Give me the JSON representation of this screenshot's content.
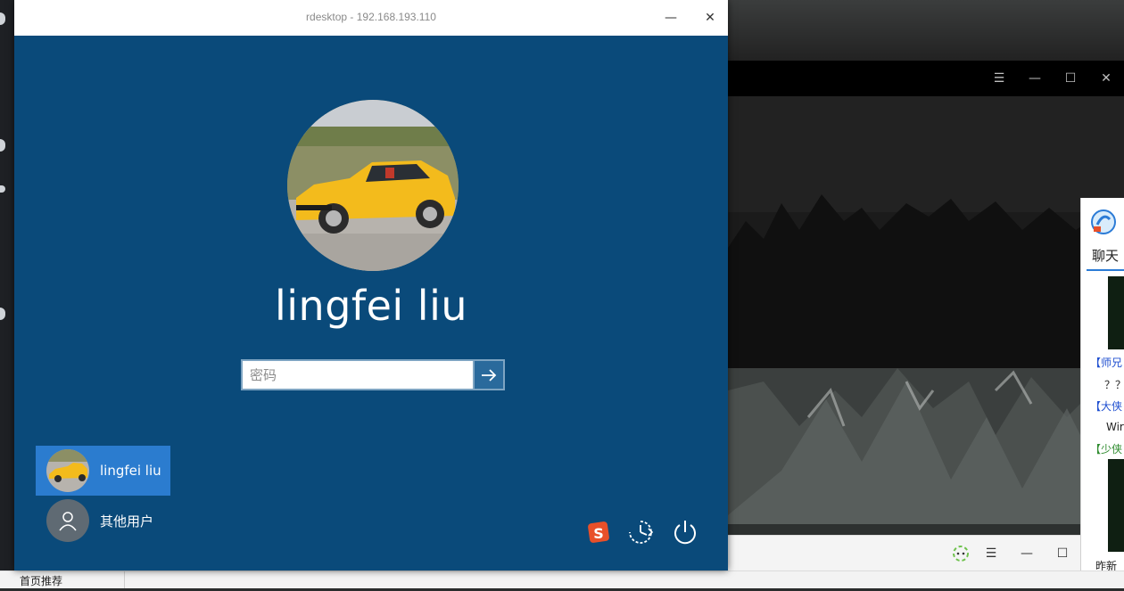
{
  "rdesktop": {
    "title": "rdesktop - 192.168.193.110",
    "minimize_label": "—",
    "close_label": "✕"
  },
  "login": {
    "user_name": "lingfei liu",
    "password_placeholder": "密码",
    "users": [
      {
        "label": "lingfei liu"
      },
      {
        "label": "其他用户"
      }
    ]
  },
  "background_window": {
    "title_buttons": [
      "☰",
      "—",
      "☐",
      "✕"
    ],
    "bottom_buttons": [
      "☰",
      "—",
      "☐"
    ]
  },
  "chat_panel": {
    "tab": "聊天",
    "lines": [
      "【师兄",
      "？？",
      "【大侠",
      "Wir",
      "【少侠",
      "昨新"
    ]
  },
  "taskbar": {
    "tab_label": "首页推荐"
  },
  "colors": {
    "login_bg": "#0a4a7a",
    "tile_selected": "#2b7ccf",
    "accent_blue": "#2b7bd6"
  },
  "icons": {
    "submit": "arrow-right-icon",
    "ime": "sogou-ime-icon",
    "ease_of_access": "ease-of-access-icon",
    "power": "power-icon",
    "other_user": "user-silhouette-icon"
  }
}
